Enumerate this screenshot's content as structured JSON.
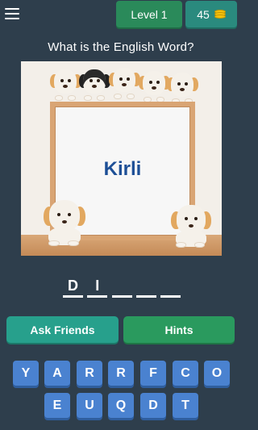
{
  "header": {
    "menu_icon": "hamburger-menu-icon",
    "level_label": "Level 1",
    "coins": "45",
    "coins_icon": "coin-stack-icon"
  },
  "question": "What is the English Word?",
  "picture": {
    "word": "Kirli",
    "word_color": "#1d4f96"
  },
  "answer": {
    "slots": [
      "D",
      "I",
      "",
      "",
      "",
      ""
    ]
  },
  "buttons": {
    "ask_friends": "Ask Friends",
    "hints": "Hints"
  },
  "keyboard": {
    "row1": [
      "Y",
      "A",
      "R",
      "R",
      "F",
      "C",
      "O"
    ],
    "row2": [
      "E",
      "U",
      "Q",
      "D",
      "T"
    ]
  },
  "colors": {
    "background": "#2e3e4c",
    "key": "#4a82d0",
    "ask_button": "#27a08c",
    "hints_button": "#2a9a5e"
  }
}
